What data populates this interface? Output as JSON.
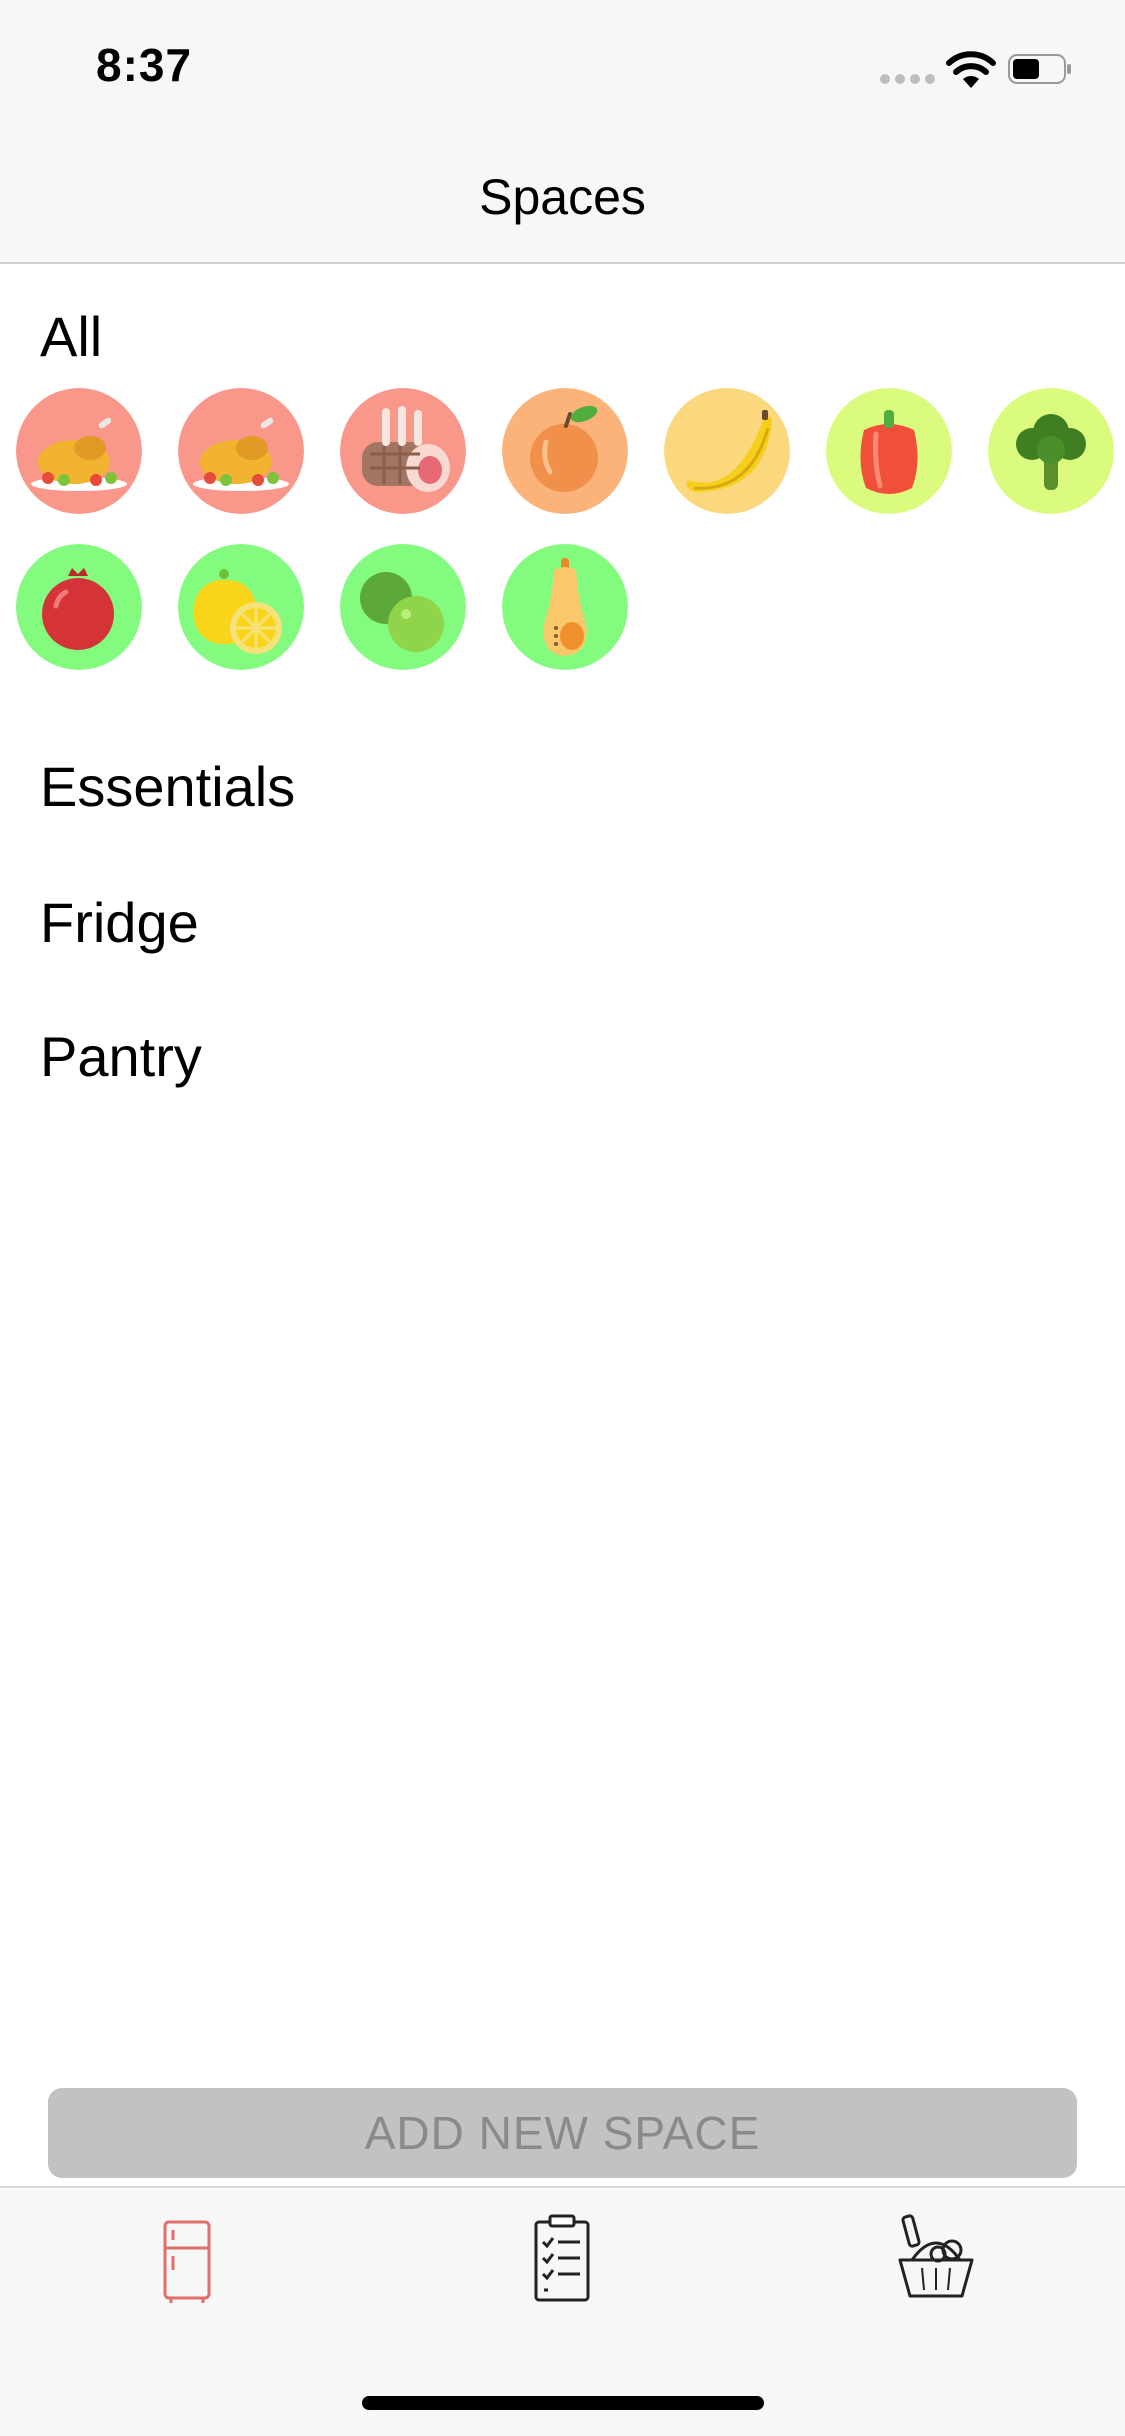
{
  "status_bar": {
    "time": "8:37",
    "icons": [
      "cellular-signal-icon",
      "wifi-icon",
      "battery-icon"
    ]
  },
  "nav_bar": {
    "title": "Spaces"
  },
  "all_section": {
    "title": "All",
    "items": [
      {
        "icon": "roast-chicken-icon",
        "bg": "#f9978a"
      },
      {
        "icon": "roast-chicken-icon",
        "bg": "#f9978a"
      },
      {
        "icon": "rack-of-lamb-icon",
        "bg": "#f9978a"
      },
      {
        "icon": "peach-icon",
        "bg": "#fbb37a"
      },
      {
        "icon": "banana-icon",
        "bg": "#fbd77e"
      },
      {
        "icon": "bell-pepper-icon",
        "bg": "#dbfb7e"
      },
      {
        "icon": "broccoli-icon",
        "bg": "#dbfb7e"
      },
      {
        "icon": "pomegranate-icon",
        "bg": "#83fb7f"
      },
      {
        "icon": "lemon-icon",
        "bg": "#83fb7f"
      },
      {
        "icon": "lime-icon",
        "bg": "#83fb7f"
      },
      {
        "icon": "butternut-squash-icon",
        "bg": "#83fb7f"
      }
    ]
  },
  "spaces": [
    {
      "label": "Essentials"
    },
    {
      "label": "Fridge"
    },
    {
      "label": "Pantry"
    }
  ],
  "add_button": {
    "label": "ADD NEW SPACE"
  },
  "tab_bar": {
    "tabs": [
      {
        "icon": "fridge-icon",
        "active": true,
        "color": "#e2706a"
      },
      {
        "icon": "checklist-icon",
        "active": false,
        "color": "#222222"
      },
      {
        "icon": "grocery-basket-icon",
        "active": false,
        "color": "#222222"
      }
    ]
  }
}
